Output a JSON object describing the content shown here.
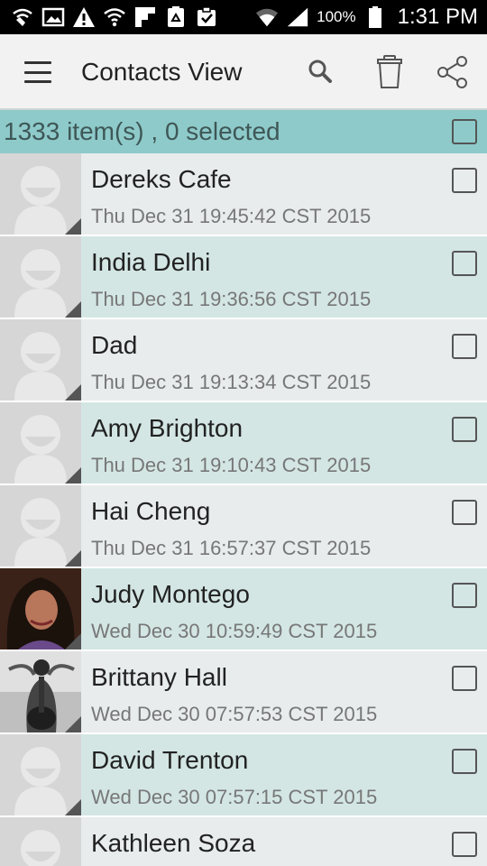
{
  "status_bar": {
    "left_icons": [
      "wifi-calling-icon",
      "gallery-icon",
      "warning-icon",
      "wifi-icon",
      "flipboard-icon",
      "recycle-icon",
      "clipboard-check-icon"
    ],
    "battery_percent": "100%",
    "time": "1:31 PM"
  },
  "app_bar": {
    "title": "Contacts View",
    "actions": [
      "search-icon",
      "delete-icon",
      "share-icon"
    ]
  },
  "selection": {
    "summary": "1333 item(s) , 0 selected",
    "select_all_checked": false
  },
  "contacts": [
    {
      "name": "Dereks Cafe",
      "date": "Thu Dec 31 19:45:42 CST 2015",
      "avatar": "placeholder",
      "checked": false
    },
    {
      "name": "India Delhi",
      "date": "Thu Dec 31 19:36:56 CST 2015",
      "avatar": "placeholder",
      "checked": false
    },
    {
      "name": "Dad",
      "date": "Thu Dec 31 19:13:34 CST 2015",
      "avatar": "placeholder",
      "checked": false
    },
    {
      "name": "Amy Brighton",
      "date": "Thu Dec 31 19:10:43 CST 2015",
      "avatar": "placeholder",
      "checked": false
    },
    {
      "name": "Hai Cheng",
      "date": "Thu Dec 31 16:57:37 CST 2015",
      "avatar": "placeholder",
      "checked": false
    },
    {
      "name": "Judy Montego",
      "date": "Wed Dec 30 10:59:49 CST 2015",
      "avatar": "photo-woman",
      "checked": false
    },
    {
      "name": "Brittany Hall",
      "date": "Wed Dec 30 07:57:53 CST 2015",
      "avatar": "photo-guitar",
      "checked": false
    },
    {
      "name": "David Trenton",
      "date": "Wed Dec 30 07:57:15 CST 2015",
      "avatar": "placeholder",
      "checked": false
    },
    {
      "name": "Kathleen Soza",
      "date": "",
      "avatar": "placeholder",
      "checked": false
    }
  ],
  "colors": {
    "status_bar": "#000000",
    "app_bar": "#f2f2f2",
    "selection_bar": "#8ecaca",
    "row_light": "#e8ecec",
    "row_tinted": "#d3e6e4"
  }
}
